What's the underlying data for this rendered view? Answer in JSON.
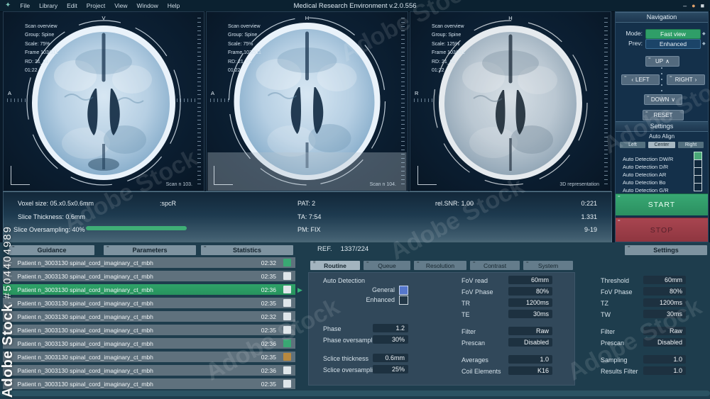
{
  "window": {
    "title": "Medical Research Environment v.2.0.556"
  },
  "menu": {
    "items": [
      "File",
      "Library",
      "Edit",
      "Project",
      "View",
      "Window",
      "Help"
    ]
  },
  "icons": {
    "logo": "✦",
    "minimize": "–",
    "circle": "●",
    "maximize": "■",
    "dash": "=",
    "row_dash": "–",
    "up": "∧",
    "down": "∨",
    "left": "‹",
    "right": "›",
    "dropdown": "◆",
    "pointer": "▶"
  },
  "watermark": {
    "brand": "Adobe Stock",
    "id": "#504404989",
    "diagonal": "Adobe Stock"
  },
  "viewports": [
    {
      "overlay": [
        "Scan overview",
        "Group: Spine",
        "Scale: 75%",
        "Frame 103/511",
        "RD: 21_01",
        "01:22"
      ],
      "corner_label": "Scan n 103.",
      "orient_top": "V",
      "orient_left": "A"
    },
    {
      "overlay": [
        "Scan overview",
        "Group: Spine",
        "Scale: 75%",
        "Frame 103/511",
        "RD: 21_01",
        "01:22"
      ],
      "corner_label": "Scan n 104.",
      "orient_top": "H",
      "orient_left": "A"
    },
    {
      "overlay": [
        "Scan overview",
        "Group: Spine",
        "Scale: 125%",
        "Frame 103/511",
        "RD: 21_01",
        "01:22"
      ],
      "corner_label": "3D representation",
      "orient_top": "H",
      "orient_left": "R"
    }
  ],
  "navigation": {
    "title": "Navigation",
    "mode_label": "Mode:",
    "mode_value": "Fast view",
    "prev_label": "Prev:",
    "prev_value": "Enhanced",
    "up": "UP",
    "left": "LEFT",
    "right": "RIGHT",
    "down": "DOWN",
    "reset": "RESET"
  },
  "settings_panel": {
    "title": "Settings",
    "auto_align": "Auto Align",
    "align_buttons": [
      "Left",
      "Center",
      "Right"
    ],
    "active_align": "Center",
    "checkboxes": [
      {
        "label": "Auto Detection DW/R",
        "checked": true
      },
      {
        "label": "Auto Detection D/R",
        "checked": false
      },
      {
        "label": "Auto Detection AR",
        "checked": false
      },
      {
        "label": "Auto Detection Bo",
        "checked": false
      },
      {
        "label": "Auto Detection G/R",
        "checked": false
      }
    ],
    "start": "START",
    "stop": "STOP"
  },
  "info_bar": {
    "voxel": "Voxel size: 05.x0.5x0.6mm",
    "spcr": ":spcR",
    "pat": "PAT: 2",
    "snr": "rel.SNR: 1.00",
    "v1": "0:221",
    "thickness": "Slice Thickness: 0.6mm",
    "ta": "TA: 7:54",
    "v2": "1.331",
    "oversampling": "Slice Oversampling: 40%",
    "pm": "PM: FIX",
    "v3": "9-19"
  },
  "bottom": {
    "tabs": [
      "Guidance",
      "Parameters",
      "Statistics"
    ],
    "ref_label": "REF.",
    "ref_value": "1337/224",
    "settings_tab": "Settings"
  },
  "patients": {
    "rows": [
      {
        "label": "Patient n_3003130 spinal_cord_imaginary_ct_mbh",
        "time": "02:32",
        "status": "green",
        "selected": false
      },
      {
        "label": "Patient n_3003130 spinal_cord_imaginary_ct_mbh",
        "time": "02:35",
        "status": "white",
        "selected": false
      },
      {
        "label": "Patient n_3003130 spinal_cord_imaginary_ct_mbh",
        "time": "02:36",
        "status": "white",
        "selected": true
      },
      {
        "label": "Patient n_3003130 spinal_cord_imaginary_ct_mbh",
        "time": "02:35",
        "status": "white",
        "selected": false
      },
      {
        "label": "Patient n_3003130 spinal_cord_imaginary_ct_mbh",
        "time": "02:32",
        "status": "white",
        "selected": false
      },
      {
        "label": "Patient n_3003130 spinal_cord_imaginary_ct_mbh",
        "time": "02:35",
        "status": "white",
        "selected": false
      },
      {
        "label": "Patient n_3003130 spinal_cord_imaginary_ct_mbh",
        "time": "02:36",
        "status": "green",
        "selected": false
      },
      {
        "label": "Patient n_3003130 spinal_cord_imaginary_ct_mbh",
        "time": "02:35",
        "status": "orange",
        "selected": false
      },
      {
        "label": "Patient n_3003130 spinal_cord_imaginary_ct_mbh",
        "time": "02:36",
        "status": "white",
        "selected": false
      },
      {
        "label": "Patient n_3003130 spinal_cord_imaginary_ct_mbh",
        "time": "02:35",
        "status": "white",
        "selected": false
      }
    ]
  },
  "routine": {
    "tabs": [
      "Routine",
      "Queue",
      "Resolution",
      "Contrast",
      "System"
    ],
    "active_tab": "Routine",
    "auto_detection": "Auto Detection",
    "general": "General",
    "general_checked": true,
    "enhanced": "Enhanced",
    "enhanced_checked": false,
    "left_fields": [
      {
        "label": "Phase",
        "value": "1.2"
      },
      {
        "label": "Phase oversampling",
        "value": "30%"
      },
      {
        "label": "Sclice thickness",
        "value": "0.6mm"
      },
      {
        "label": "Sclice oversampling",
        "value": "25%"
      }
    ],
    "mid_fields": [
      {
        "label": "FoV read",
        "value": "60mm"
      },
      {
        "label": "FoV Phase",
        "value": "80%"
      },
      {
        "label": "TR",
        "value": "1200ms"
      },
      {
        "label": "TE",
        "value": "30ms"
      },
      {
        "label": "Filter",
        "value": "Raw"
      },
      {
        "label": "Prescan",
        "value": "Disabled"
      },
      {
        "label": "Averages",
        "value": "1.0"
      },
      {
        "label": "Coil Elements",
        "value": "K16"
      }
    ]
  },
  "right_form": {
    "fields": [
      {
        "label": "Threshold",
        "value": "60mm"
      },
      {
        "label": "FoV Phase",
        "value": "80%"
      },
      {
        "label": "TZ",
        "value": "1200ms"
      },
      {
        "label": "TW",
        "value": "30ms"
      },
      {
        "label": "Filter",
        "value": "Raw"
      },
      {
        "label": "Prescan",
        "value": "Disabled"
      },
      {
        "label": "Sampling",
        "value": "1.0"
      },
      {
        "label": "Results Filter",
        "value": "1.0"
      }
    ]
  }
}
